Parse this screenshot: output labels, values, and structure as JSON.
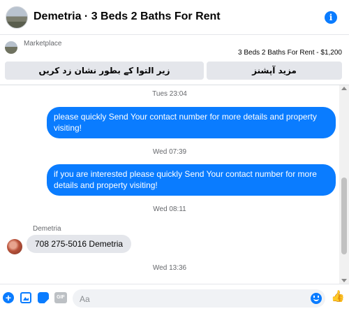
{
  "header": {
    "title": "Demetria · 3 Beds 2 Baths For Rent",
    "info_glyph": "i"
  },
  "marketplace": {
    "label": "Marketplace",
    "listing": "3 Beds 2 Baths For Rent - $1,200",
    "report_button": "زیر التوا کے بطور نشان زد کریں",
    "more_button": "مزید آپشنز"
  },
  "chat": {
    "timestamps": [
      "Tues 23:04",
      "Wed 07:39",
      "Wed 08:11",
      "Wed 13:36"
    ],
    "messages": [
      {
        "from": "me",
        "text": "please quickly Send Your contact number for more details and property visiting!"
      },
      {
        "from": "me",
        "text": "if you are interested please quickly Send Your contact number for more details and property visiting!"
      },
      {
        "from": "Demetria",
        "sender_label": "Demetria",
        "text": "708 275-5016 Demetria"
      }
    ]
  },
  "composer": {
    "placeholder": "Aa",
    "gif_label": "GIF",
    "plus_glyph": "+",
    "like_glyph": "👍",
    "icons": [
      "plus-icon",
      "photo-icon",
      "sticker-icon",
      "gif-icon",
      "emoji-icon",
      "thumbs-up-icon"
    ]
  },
  "colors": {
    "accent": "#0a7cff",
    "bubble_in": "#e4e6eb",
    "muted_text": "#65676b"
  }
}
